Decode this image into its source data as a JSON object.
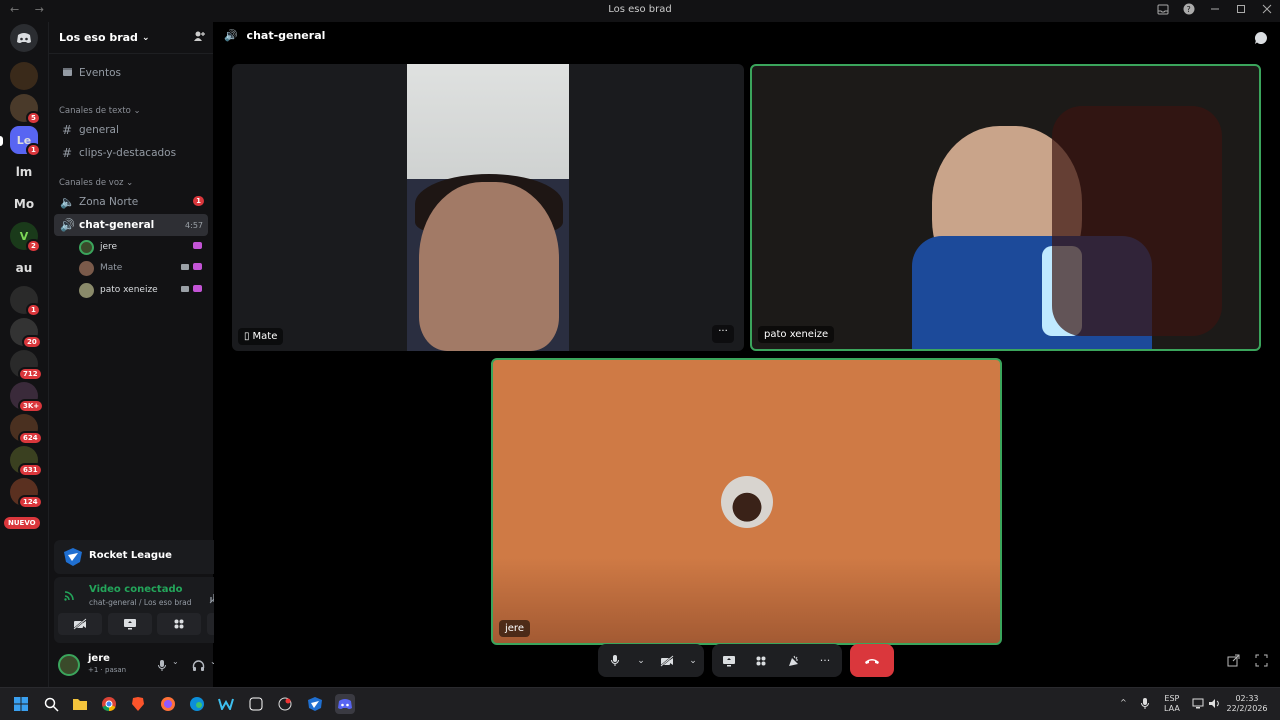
{
  "titlebar": {
    "title": "Los eso brad",
    "back": "←",
    "forward": "→"
  },
  "servers": {
    "items": [
      {
        "label": "",
        "badge": ""
      },
      {
        "label": "",
        "badge": "5"
      },
      {
        "label": "Le",
        "badge": "1"
      },
      {
        "label": "lm",
        "badge": ""
      },
      {
        "label": "Mo",
        "badge": ""
      },
      {
        "label": "",
        "badge": "2"
      },
      {
        "label": "au",
        "badge": ""
      },
      {
        "label": "",
        "badge": "1"
      },
      {
        "label": "",
        "badge": "20"
      },
      {
        "label": "",
        "badge": "712"
      },
      {
        "label": "",
        "badge": "3K+"
      },
      {
        "label": "",
        "badge": "624"
      },
      {
        "label": "",
        "badge": "631"
      },
      {
        "label": "",
        "badge": "124"
      }
    ],
    "nuevo": "NUEVO"
  },
  "guild": {
    "name": "Los eso brad",
    "events": "Eventos",
    "text_category": "Canales de texto",
    "text_channels": [
      "general",
      "clips-y-destacados"
    ],
    "voice_category": "Canales de voz",
    "voice_channels": [
      {
        "name": "Zona Norte",
        "badge": "1"
      },
      {
        "name": "chat-general",
        "timer": "4:57"
      }
    ],
    "voice_users": [
      "jere",
      "Mate",
      "pato xeneize"
    ]
  },
  "activity": {
    "game": "Rocket League"
  },
  "voice_panel": {
    "status": "Video conectado",
    "location": "chat-general / Los eso brad"
  },
  "user": {
    "name": "jere",
    "status": "+1 · pasan"
  },
  "main": {
    "channel": "chat-general",
    "tiles": [
      {
        "name": "Mate"
      },
      {
        "name": "pato xeneize"
      },
      {
        "name": "jere"
      }
    ]
  },
  "taskbar": {
    "lang1": "ESP",
    "lang2": "LAA",
    "time": "02:33",
    "date": "22/2/2026"
  },
  "colors": {
    "accent": "#5865f2",
    "speaking": "#3ba55c",
    "danger": "#da373c",
    "voice_status": "#23a55a"
  }
}
